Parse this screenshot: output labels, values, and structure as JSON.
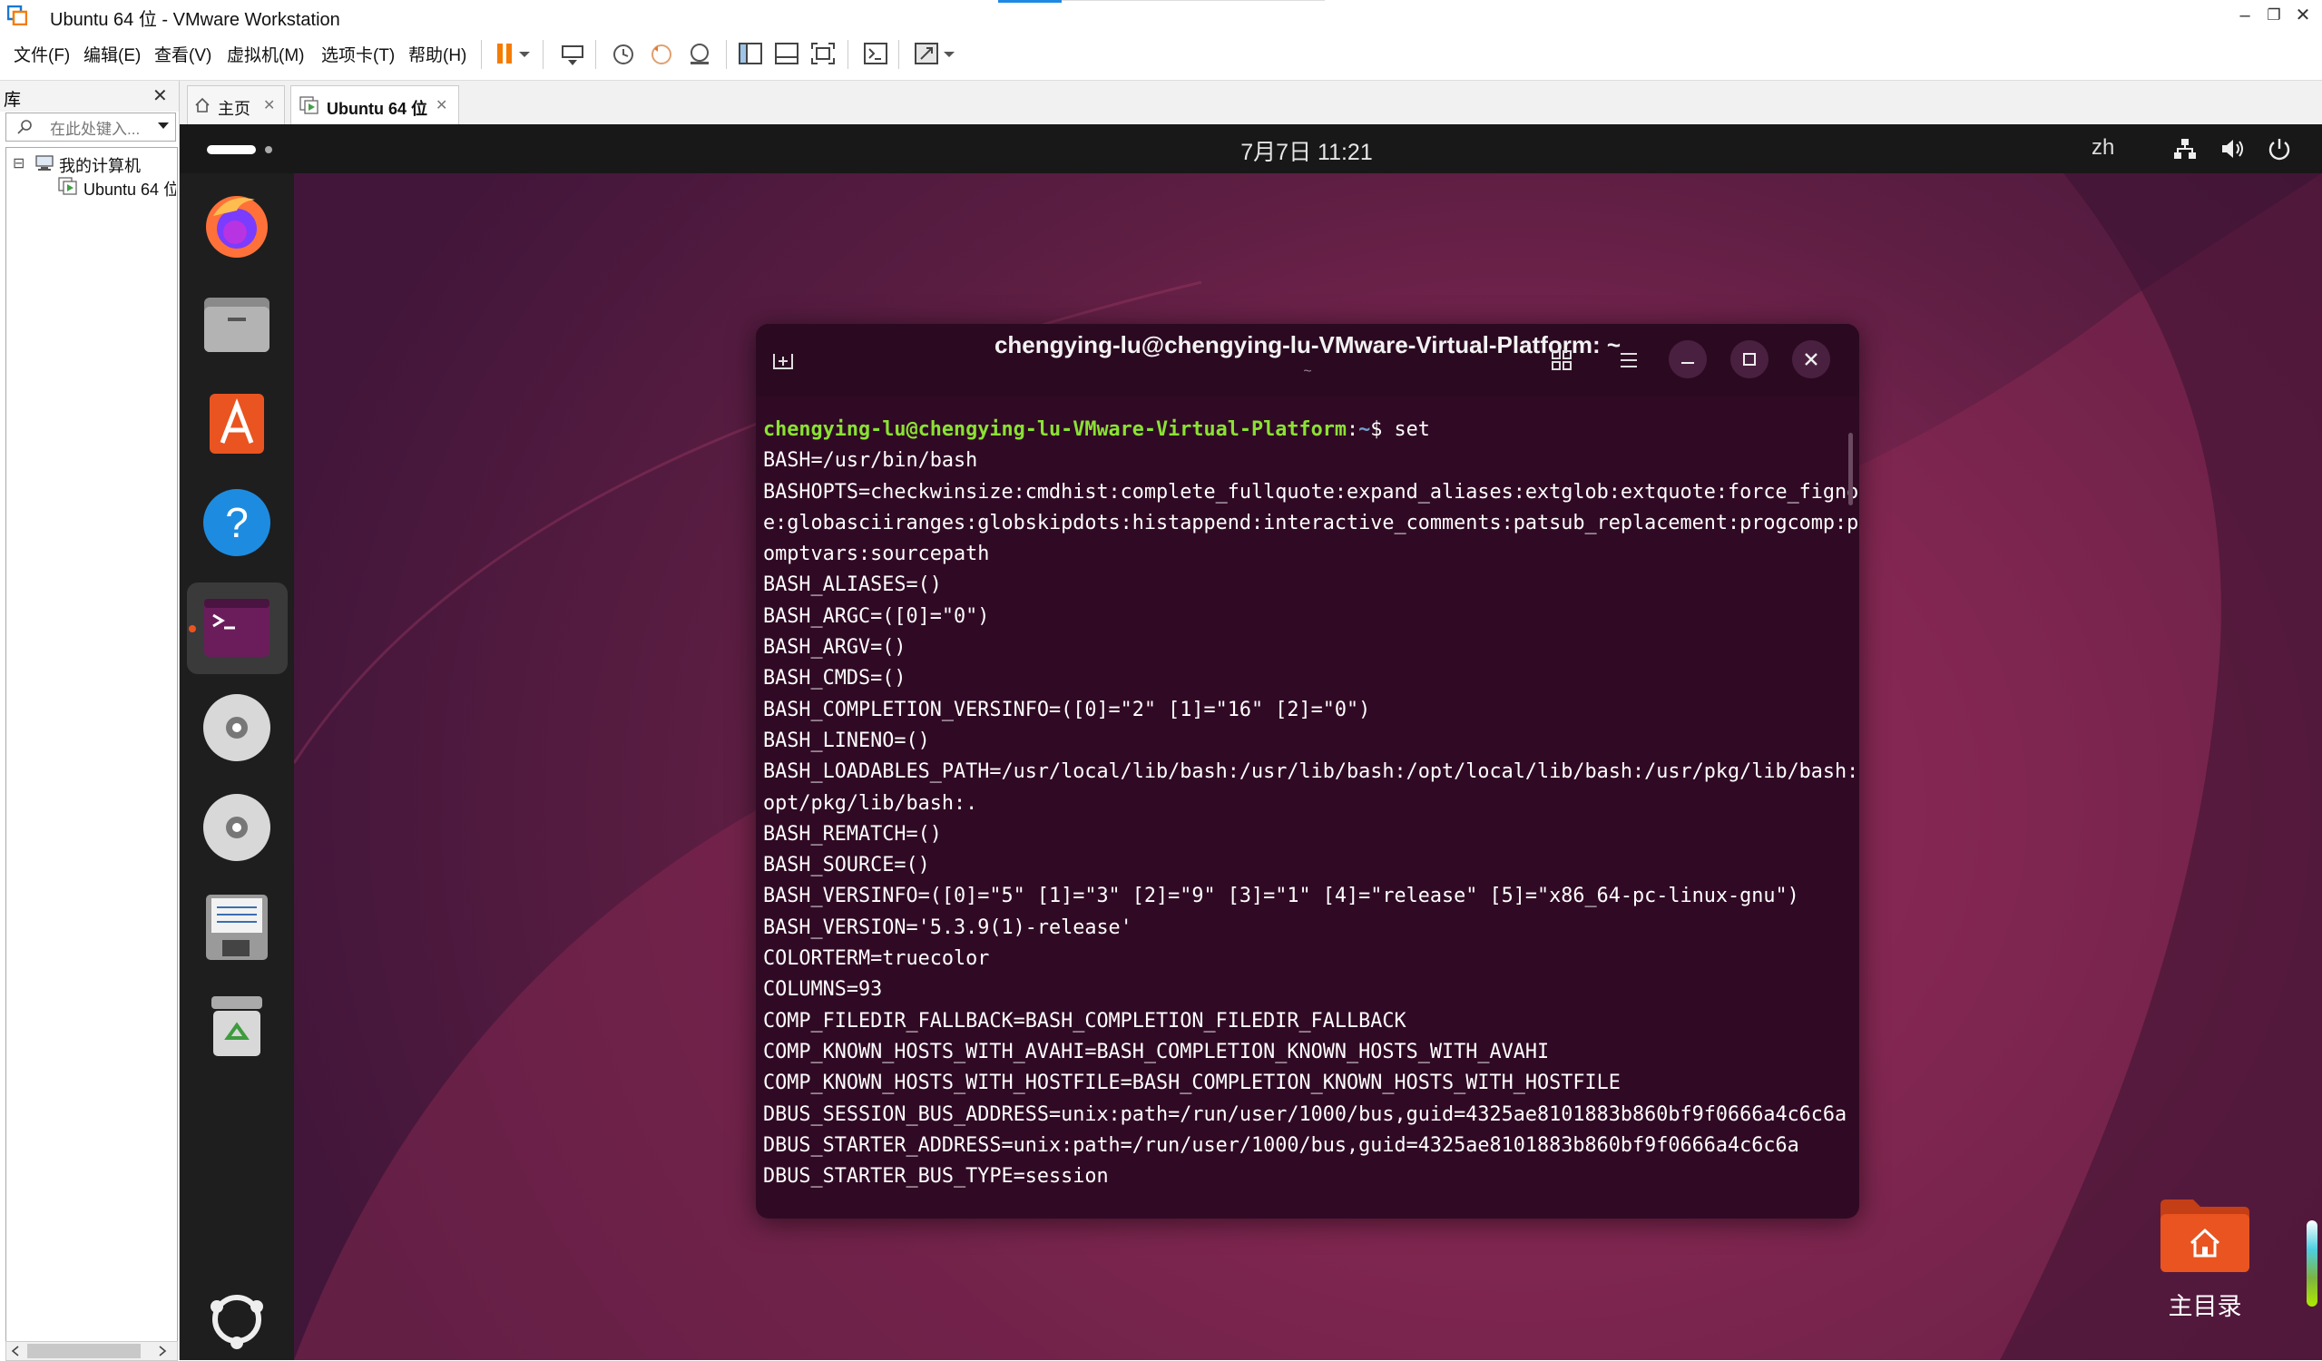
{
  "window": {
    "title": "Ubuntu 64 位 - VMware Workstation",
    "controls": {
      "minimize": "–",
      "restore": "❐",
      "close": "✕"
    }
  },
  "menu": [
    "文件(F)",
    "编辑(E)",
    "查看(V)",
    "虚拟机(M)",
    "选项卡(T)",
    "帮助(H)"
  ],
  "library": {
    "title": "库",
    "close": "✕",
    "search_placeholder": "在此处键入...",
    "tree": {
      "root": "我的计算机",
      "child": "Ubuntu 64 位"
    },
    "collapse_glyph": "⊟"
  },
  "tabs": [
    {
      "label": "主页",
      "close": "✕",
      "icon": "home-icon"
    },
    {
      "label": "Ubuntu 64 位",
      "close": "✕",
      "icon": "vm-running-icon"
    }
  ],
  "gnome": {
    "clock": "7月7日  11:21",
    "input_method": "zh",
    "status_icons": [
      "network-icon",
      "volume-icon",
      "power-icon"
    ]
  },
  "dock": [
    "firefox",
    "files",
    "app-center",
    "help",
    "terminal",
    "dvd-drive-1",
    "dvd-drive-2",
    "floppy-drive",
    "trash",
    "show-apps"
  ],
  "terminal": {
    "title": "chengying-lu@chengying-lu-VMware-Virtual-Platform: ~",
    "subtitle": "~",
    "prompt_user": "chengying-lu@chengying-lu-VMware-Virtual-Platform",
    "prompt_sep": ":",
    "prompt_path": "~",
    "prompt_tail": "$ set",
    "lines": [
      "BASH=/usr/bin/bash",
      "BASHOPTS=checkwinsize:cmdhist:complete_fullquote:expand_aliases:extglob:extquote:force_fignor",
      "e:globasciiranges:globskipdots:histappend:interactive_comments:patsub_replacement:progcomp:pr",
      "omptvars:sourcepath",
      "BASH_ALIASES=()",
      "BASH_ARGC=([0]=\"0\")",
      "BASH_ARGV=()",
      "BASH_CMDS=()",
      "BASH_COMPLETION_VERSINFO=([0]=\"2\" [1]=\"16\" [2]=\"0\")",
      "BASH_LINENO=()",
      "BASH_LOADABLES_PATH=/usr/local/lib/bash:/usr/lib/bash:/opt/local/lib/bash:/usr/pkg/lib/bash:/",
      "opt/pkg/lib/bash:.",
      "BASH_REMATCH=()",
      "BASH_SOURCE=()",
      "BASH_VERSINFO=([0]=\"5\" [1]=\"3\" [2]=\"9\" [3]=\"1\" [4]=\"release\" [5]=\"x86_64-pc-linux-gnu\")",
      "BASH_VERSION='5.3.9(1)-release'",
      "COLORTERM=truecolor",
      "COLUMNS=93",
      "COMP_FILEDIR_FALLBACK=BASH_COMPLETION_FILEDIR_FALLBACK",
      "COMP_KNOWN_HOSTS_WITH_AVAHI=BASH_COMPLETION_KNOWN_HOSTS_WITH_AVAHI",
      "COMP_KNOWN_HOSTS_WITH_HOSTFILE=BASH_COMPLETION_KNOWN_HOSTS_WITH_HOSTFILE",
      "DBUS_SESSION_BUS_ADDRESS=unix:path=/run/user/1000/bus,guid=4325ae8101883b860bf9f0666a4c6c6a",
      "DBUS_STARTER_ADDRESS=unix:path=/run/user/1000/bus,guid=4325ae8101883b860bf9f0666a4c6c6a",
      "DBUS_STARTER_BUS_TYPE=session"
    ]
  },
  "desktop": {
    "home_label": "主目录"
  },
  "colors": {
    "terminal_bg": "#300a24",
    "prompt_user": "#8ae234",
    "prompt_path": "#729fcf",
    "dock_running_dot": "#e95420",
    "folder": "#e95420"
  }
}
